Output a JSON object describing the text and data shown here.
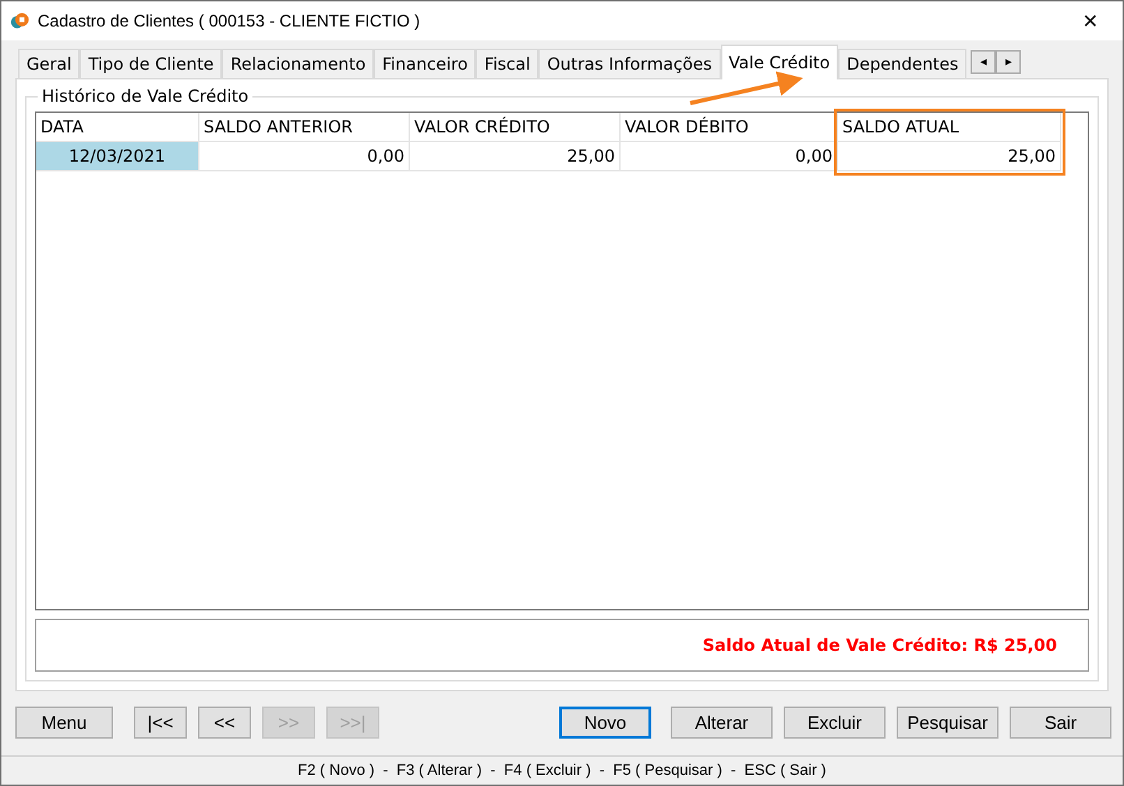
{
  "window": {
    "title": "Cadastro de Clientes ( 000153 - CLIENTE FICTIO )",
    "close": "✕"
  },
  "tabs": [
    {
      "label": "Geral",
      "selected": false
    },
    {
      "label": "Tipo de Cliente",
      "selected": false
    },
    {
      "label": "Relacionamento",
      "selected": false
    },
    {
      "label": "Financeiro",
      "selected": false
    },
    {
      "label": "Fiscal",
      "selected": false
    },
    {
      "label": "Outras Informações",
      "selected": false
    },
    {
      "label": "Vale Crédito",
      "selected": true
    },
    {
      "label": "Dependentes",
      "selected": false
    }
  ],
  "tab_scroll": [
    "◂",
    "▸"
  ],
  "group": {
    "title": "Histórico de Vale Crédito"
  },
  "table": {
    "columns": [
      {
        "label": "DATA",
        "highlighted": false
      },
      {
        "label": "SALDO ANTERIOR",
        "highlighted": false
      },
      {
        "label": "VALOR CRÉDITO",
        "highlighted": false
      },
      {
        "label": "VALOR DÉBITO",
        "highlighted": false
      },
      {
        "label": "SALDO ATUAL",
        "highlighted": true
      }
    ],
    "rows": [
      {
        "cells": [
          "12/03/2021",
          "0,00",
          "25,00",
          "0,00",
          "25,00"
        ],
        "selected": true
      }
    ]
  },
  "summary": "Saldo Atual de Vale Crédito: R$ 25,00",
  "nav_buttons": [
    {
      "label": "Menu",
      "disabled": false
    },
    {
      "label": "|<<",
      "disabled": false
    },
    {
      "label": "<<",
      "disabled": false
    },
    {
      "label": ">>",
      "disabled": true
    },
    {
      "label": ">>|",
      "disabled": true
    }
  ],
  "action_buttons": [
    {
      "label": "Novo",
      "focused": true
    },
    {
      "label": "Alterar",
      "focused": false
    },
    {
      "label": "Excluir",
      "focused": false
    },
    {
      "label": "Pesquisar",
      "focused": false
    },
    {
      "label": "Sair",
      "focused": false
    }
  ],
  "status_bar": "F2 ( Novo )  -  F3 ( Alterar )  -  F4 ( Excluir )  -  F5 ( Pesquisar )  -  ESC ( Sair )"
}
